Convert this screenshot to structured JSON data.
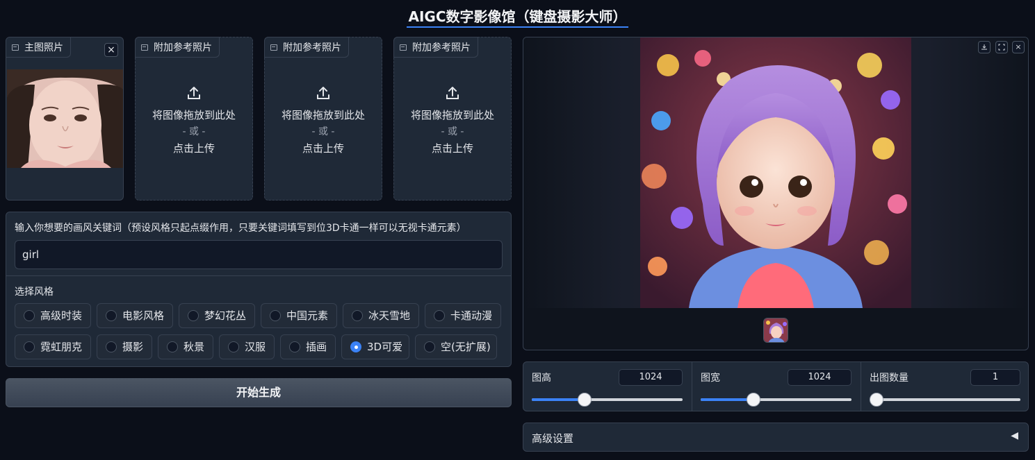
{
  "title": "AIGC数字影像馆（键盘摄影大师）",
  "main_photo": {
    "label": "主图照片",
    "close": "×"
  },
  "ref_photos": [
    {
      "label": "附加参考照片",
      "drop": "将图像拖放到此处",
      "or": "- 或 -",
      "click": "点击上传"
    },
    {
      "label": "附加参考照片",
      "drop": "将图像拖放到此处",
      "or": "- 或 -",
      "click": "点击上传"
    },
    {
      "label": "附加参考照片",
      "drop": "将图像拖放到此处",
      "or": "- 或 -",
      "click": "点击上传"
    }
  ],
  "keyword": {
    "label": "输入你想要的画风关键词（预设风格只起点缀作用，只要关键词填写到位3D卡通一样可以无视卡通元素）",
    "value": "girl"
  },
  "style": {
    "label": "选择风格",
    "options": [
      "高级时装",
      "电影风格",
      "梦幻花丛",
      "中国元素",
      "冰天雪地",
      "卡通动漫",
      "霓虹朋克",
      "摄影",
      "秋景",
      "汉服",
      "插画",
      "3D可爱",
      "空(无扩展)"
    ],
    "selected": "3D可爱"
  },
  "generate_button": "开始生成",
  "output": {
    "download_icon": "download-icon",
    "fullscreen_icon": "fullscreen-icon",
    "close": "×"
  },
  "sliders": [
    {
      "label": "图高",
      "value": "1024",
      "fraction": 0.35
    },
    {
      "label": "图宽",
      "value": "1024",
      "fraction": 0.35
    },
    {
      "label": "出图数量",
      "value": "1",
      "fraction": 0.0
    }
  ],
  "advanced": {
    "label": "高级设置",
    "arrow": "◀"
  },
  "colors": {
    "accent": "#3b82f6",
    "background": "#0b0f19",
    "panel": "#1f2937"
  }
}
